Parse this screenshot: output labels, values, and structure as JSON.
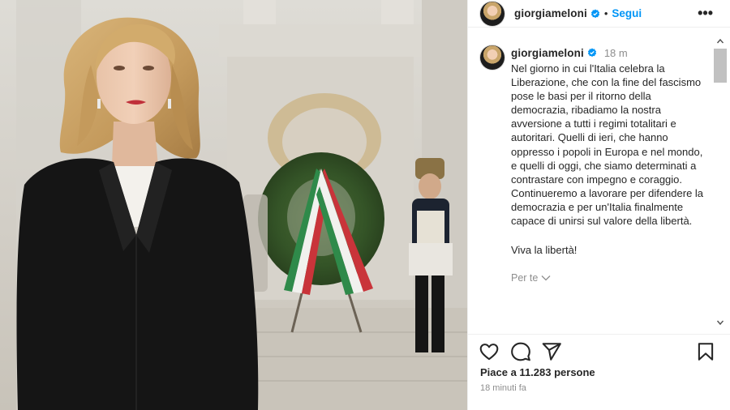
{
  "post": {
    "username": "giorgiameloni",
    "follow_label": "Segui",
    "separator": "•",
    "more_label": "•••",
    "caption_time": "18 m",
    "caption_text": "Nel giorno in cui l'Italia celebra la Liberazione, che con la fine del fascismo pose le basi per il ritorno della democrazia, ribadiamo la nostra avversione a tutti i regimi totalitari e autoritari. Quelli di ieri, che hanno oppresso i popoli in Europa e nel mondo, e quelli di oggi, che siamo determinati a contrastare con impegno e coraggio. Continueremo a lavorare per difendere la democrazia e per un'Italia finalmente capace di unirsi sul valore della libertà.",
    "caption_closing": "Viva la libertà!",
    "for_you_label": "Per te",
    "likes_text": "Piace a 11.283 persone",
    "posted_ago": "18 minuti fa"
  },
  "icons": {
    "verified": "verified-badge-icon",
    "like": "heart-icon",
    "comment": "comment-icon",
    "share": "paper-plane-icon",
    "save": "bookmark-icon",
    "chevron": "chevron-down-icon"
  },
  "colors": {
    "accent": "#0095f6",
    "text": "#262626",
    "muted": "#8e8e8e",
    "jacket": "#141414"
  }
}
